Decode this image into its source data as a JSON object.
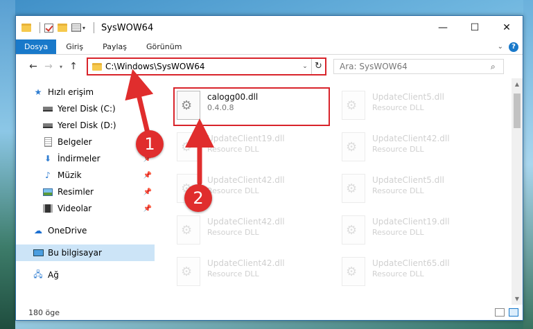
{
  "window": {
    "title": "SysWOW64",
    "controls": {
      "minimize": "—",
      "maximize": "☐",
      "close": "✕"
    }
  },
  "ribbon": {
    "tabs": [
      "Dosya",
      "Giriş",
      "Paylaş",
      "Görünüm"
    ],
    "help": "?"
  },
  "address": {
    "path": "C:\\Windows\\SysWOW64",
    "search_placeholder": "Ara: SysWOW64"
  },
  "sidebar": {
    "quick_access": "Hızlı erişim",
    "items": [
      {
        "label": "Yerel Disk (C:)",
        "icon": "drive-icon"
      },
      {
        "label": "Yerel Disk (D:)",
        "icon": "drive-icon"
      },
      {
        "label": "Belgeler",
        "icon": "document-icon"
      },
      {
        "label": "İndirmeler",
        "icon": "download-icon"
      },
      {
        "label": "Müzik",
        "icon": "music-icon"
      },
      {
        "label": "Resimler",
        "icon": "pictures-icon"
      },
      {
        "label": "Videolar",
        "icon": "video-icon"
      }
    ],
    "onedrive": "OneDrive",
    "this_pc": "Bu bilgisayar",
    "network": "Ağ"
  },
  "files": {
    "primary": {
      "name": "calogg00.dll",
      "version": "0.4.0.8"
    },
    "ghosts": [
      {
        "name": "UpdateClient5.dll",
        "type": "Resource DLL"
      },
      {
        "name": "UpdateClient19.dll",
        "type": "Resource DLL"
      },
      {
        "name": "UpdateClient42.dll",
        "type": "Resource DLL"
      },
      {
        "name": "UpdateClient42.dll",
        "type": "Resource DLL"
      },
      {
        "name": "UpdateClient5.dll",
        "type": "Resource DLL"
      },
      {
        "name": "UpdateClient42.dll",
        "type": "Resource DLL"
      },
      {
        "name": "UpdateClient19.dll",
        "type": "Resource DLL"
      },
      {
        "name": "UpdateClient42.dll",
        "type": "Resource DLL"
      },
      {
        "name": "UpdateClient65.dll",
        "type": "Resource DLL"
      }
    ]
  },
  "status": {
    "count": "180 öge"
  },
  "annotations": {
    "step1": "1",
    "step2": "2"
  },
  "colors": {
    "accent": "#1979ca",
    "highlight": "#d8232a",
    "badge": "#e02d2d",
    "selected": "#cce4f7"
  }
}
